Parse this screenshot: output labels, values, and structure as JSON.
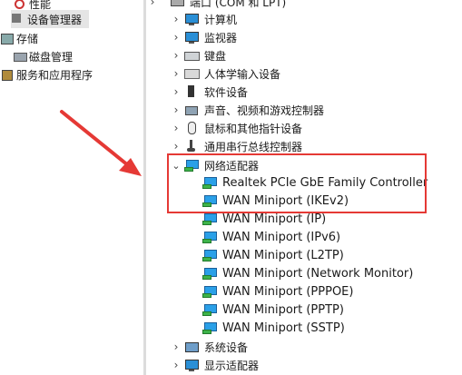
{
  "left_tree": [
    {
      "label": "性能",
      "icon": "performance-icon",
      "selected": false
    },
    {
      "label": "设备管理器",
      "icon": "device-manager-icon",
      "selected": true
    },
    {
      "label": "存储",
      "icon": "storage-icon",
      "selected": false
    },
    {
      "label": "磁盘管理",
      "icon": "disk-icon",
      "selected": false
    },
    {
      "label": "服务和应用程序",
      "icon": "services-icon",
      "selected": false
    }
  ],
  "device_tree": {
    "top_items": [
      {
        "label": "端口 (COM 和 LPT)",
        "icon": "port-icon"
      },
      {
        "label": "计算机",
        "icon": "computer-icon"
      },
      {
        "label": "监视器",
        "icon": "monitor-icon"
      },
      {
        "label": "键盘",
        "icon": "keyboard-icon"
      },
      {
        "label": "人体学输入设备",
        "icon": "hid-icon"
      },
      {
        "label": "软件设备",
        "icon": "software-device-icon"
      },
      {
        "label": "声音、视频和游戏控制器",
        "icon": "sound-icon"
      },
      {
        "label": "鼠标和其他指针设备",
        "icon": "mouse-icon"
      },
      {
        "label": "通用串行总线控制器",
        "icon": "usb-icon"
      }
    ],
    "network": {
      "label": "网络适配器",
      "icon": "network-adapter-icon",
      "expanded": true,
      "children": [
        "Realtek PCIe GbE Family Controller",
        "WAN Miniport (IKEv2)",
        "WAN Miniport (IP)",
        "WAN Miniport (IPv6)",
        "WAN Miniport (L2TP)",
        "WAN Miniport (Network Monitor)",
        "WAN Miniport (PPPOE)",
        "WAN Miniport (PPTP)",
        "WAN Miniport (SSTP)"
      ]
    },
    "bottom_items": [
      {
        "label": "系统设备",
        "icon": "system-device-icon"
      },
      {
        "label": "显示适配器",
        "icon": "display-adapter-icon"
      }
    ]
  },
  "colors": {
    "highlight": "#e53935",
    "arrow": "#e53935",
    "selection": "#e5e5e5"
  }
}
